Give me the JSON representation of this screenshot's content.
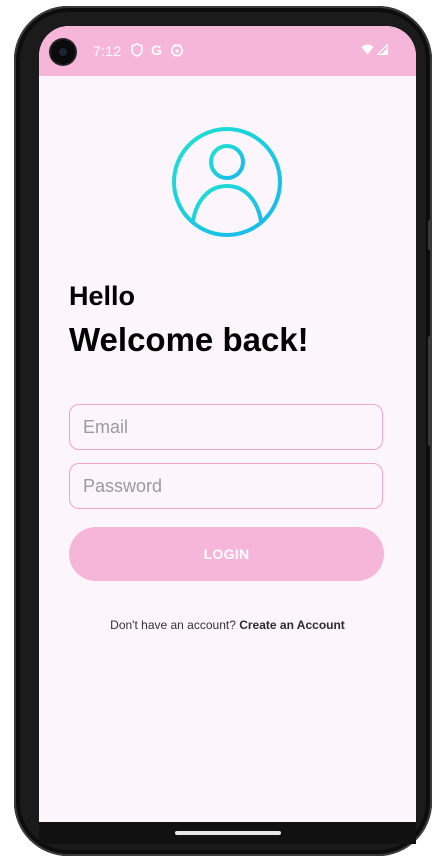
{
  "status_bar": {
    "time": "7:12",
    "icons_left": [
      "shield-icon",
      "google-g-icon",
      "app-notification-icon"
    ],
    "icons_right": [
      "wifi-icon",
      "cell-signal-icon"
    ],
    "google_glyph": "G"
  },
  "screen": {
    "greeting": "Hello",
    "welcome": "Welcome back!"
  },
  "form": {
    "email_placeholder": "Email",
    "password_placeholder": "Password",
    "login_label": "LOGIN"
  },
  "signup": {
    "prompt": "Don't have an account? ",
    "link_label": "Create an Account"
  },
  "colors": {
    "accent": "#f6b6d9",
    "background": "#fdf5fc",
    "field_border": "#f1a4cd",
    "avatar_gradient_start": "#1ee3d0",
    "avatar_gradient_end": "#1ab6ee"
  }
}
